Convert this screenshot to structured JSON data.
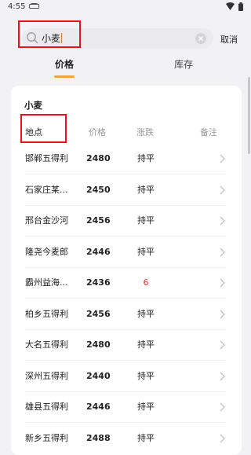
{
  "status_bar": {
    "time": "4:55"
  },
  "search": {
    "value": "小麦",
    "cancel_label": "取消"
  },
  "tabs": [
    {
      "label": "价格",
      "active": true
    },
    {
      "label": "库存",
      "active": false
    }
  ],
  "section": {
    "title": "小麦",
    "columns": [
      "地点",
      "价格",
      "涨跌",
      "备注"
    ]
  },
  "rows": [
    {
      "location": "邯郸五得利",
      "price": "2480",
      "change": "持平"
    },
    {
      "location": "石家庄某...",
      "price": "2450",
      "change": "持平"
    },
    {
      "location": "邢台金沙河",
      "price": "2456",
      "change": "持平"
    },
    {
      "location": "隆尧今麦郎",
      "price": "2446",
      "change": "持平"
    },
    {
      "location": "霸州益海...",
      "price": "2436",
      "change": "6"
    },
    {
      "location": "柏乡五得利",
      "price": "2456",
      "change": "持平"
    },
    {
      "location": "大名五得利",
      "price": "2480",
      "change": "持平"
    },
    {
      "location": "深州五得利",
      "price": "2440",
      "change": "持平"
    },
    {
      "location": "雄县五得利",
      "price": "2446",
      "change": "持平"
    },
    {
      "location": "新乡五得利",
      "price": "2488",
      "change": "持平"
    }
  ],
  "colors": {
    "accent": "#f2a24a",
    "highlight_box": "#e8131c",
    "price_up": "#e0322f"
  }
}
